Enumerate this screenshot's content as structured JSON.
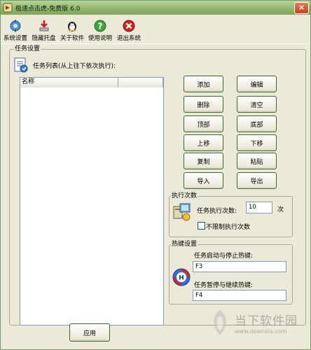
{
  "window": {
    "title": "极速点击虎-免费版 6.0"
  },
  "toolbar": {
    "items": [
      {
        "label": "系统设置",
        "icon": "settings-icon"
      },
      {
        "label": "隐藏托盘",
        "icon": "hide-tray-icon"
      },
      {
        "label": "关于软件",
        "icon": "penguin-icon"
      },
      {
        "label": "使用说明",
        "icon": "help-icon"
      },
      {
        "label": "退出系统",
        "icon": "exit-icon"
      }
    ]
  },
  "task_settings": {
    "legend": "任务设置",
    "list_title": "任务列表(从上往下依次执行):",
    "columns": [
      "名称",
      ""
    ]
  },
  "buttons": {
    "add": "添加",
    "edit": "编辑",
    "delete": "删除",
    "clear": "清空",
    "top": "顶部",
    "bottom": "底部",
    "move_up": "上移",
    "move_down": "下移",
    "copy": "复制",
    "paste": "粘贴",
    "import": "导入",
    "export": "导出",
    "apply": "应用"
  },
  "exec_count": {
    "legend": "执行次数",
    "label": "任务执行次数:",
    "value": "10",
    "unit": "次",
    "unlimited_label": "不限制执行次数",
    "unlimited_checked": false
  },
  "hotkeys": {
    "legend": "热键设置",
    "start_stop_label": "任务启动与停止热键:",
    "start_stop_value": "F3",
    "pause_resume_label": "任务暂停与继续热键:",
    "pause_resume_value": "F4"
  },
  "watermark": {
    "text_cn": "当下软件园",
    "url": "www.downxia.com"
  }
}
